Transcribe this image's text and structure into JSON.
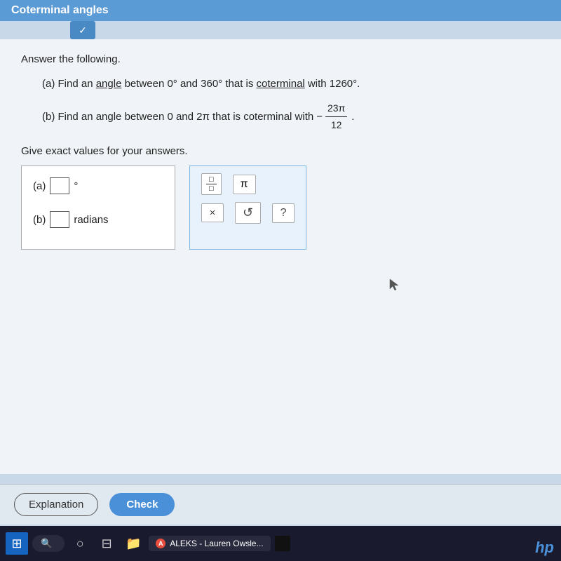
{
  "topbar": {
    "title": "Coterminal angles",
    "chevron_symbol": "✓"
  },
  "content": {
    "instruction": "Answer the following.",
    "question_a": {
      "label": "(a)",
      "text_before": "Find an",
      "word1": "angle",
      "text_middle": "between 0° and 360° that is",
      "word2": "coterminal",
      "text_after": "with 1260°."
    },
    "question_b": {
      "label": "(b)",
      "text_before": "Find an angle between 0 and 2π that is coterminal with",
      "fraction": {
        "numerator": "23π",
        "denominator": "12",
        "sign": "−"
      },
      "text_after": "."
    },
    "give_exact": "Give exact values for your answers.",
    "answer_a": {
      "label": "(a)",
      "unit": "°"
    },
    "answer_b": {
      "label": "(b)",
      "unit": "radians"
    }
  },
  "keyboard": {
    "fraction_top": "□",
    "fraction_bot": "□",
    "pi_symbol": "π",
    "x_symbol": "×",
    "undo_symbol": "↺",
    "help_symbol": "?"
  },
  "actions": {
    "explanation_label": "Explanation",
    "check_label": "Check"
  },
  "taskbar": {
    "search_placeholder": "Search",
    "aleks_label": "ALEKS - Lauren Owsle...",
    "start_icon": "⊞"
  }
}
